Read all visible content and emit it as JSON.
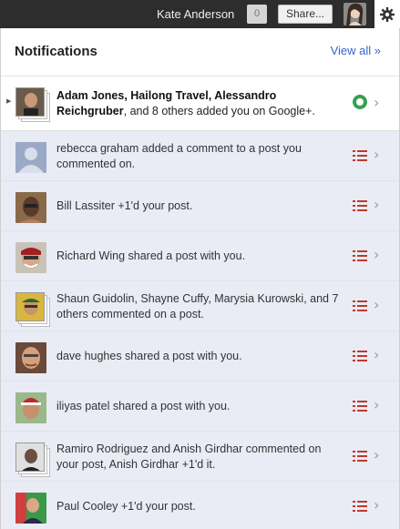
{
  "topbar": {
    "user_name": "Kate Anderson",
    "notification_count": "0",
    "share_label": "Share..."
  },
  "panel": {
    "title": "Notifications",
    "view_all": "View all »"
  },
  "colors": {
    "unread_bg": "#ffffff",
    "read_bg": "#e9ecf5",
    "link": "#3366cc",
    "status_green": "#35a153",
    "list_icon_red": "#c0392b"
  },
  "notifications": [
    {
      "bold": "Adam Jones, Hailong Travel, Alessandro Reichgruber",
      "text": ", and 8 others added you on Google+.",
      "icon": "green-circle-icon"
    },
    {
      "text": "rebecca graham added a comment to a post you commented on.",
      "icon": "list-icon"
    },
    {
      "text": "Bill Lassiter +1'd your post.",
      "icon": "list-icon"
    },
    {
      "text": "Richard Wing shared a post with you.",
      "icon": "list-icon"
    },
    {
      "text": "Shaun Guidolin, Shayne Cuffy, Marysia Kurowski, and 7 others commented on a post.",
      "icon": "list-icon"
    },
    {
      "text": "dave hughes shared a post with you.",
      "icon": "list-icon"
    },
    {
      "text": "iliyas patel shared a post with you.",
      "icon": "list-icon"
    },
    {
      "text": "Ramiro Rodriguez and Anish Girdhar commented on your post, Anish Girdhar +1'd it.",
      "icon": "list-icon"
    },
    {
      "text": "Paul Cooley +1'd your post.",
      "icon": "list-icon"
    }
  ]
}
